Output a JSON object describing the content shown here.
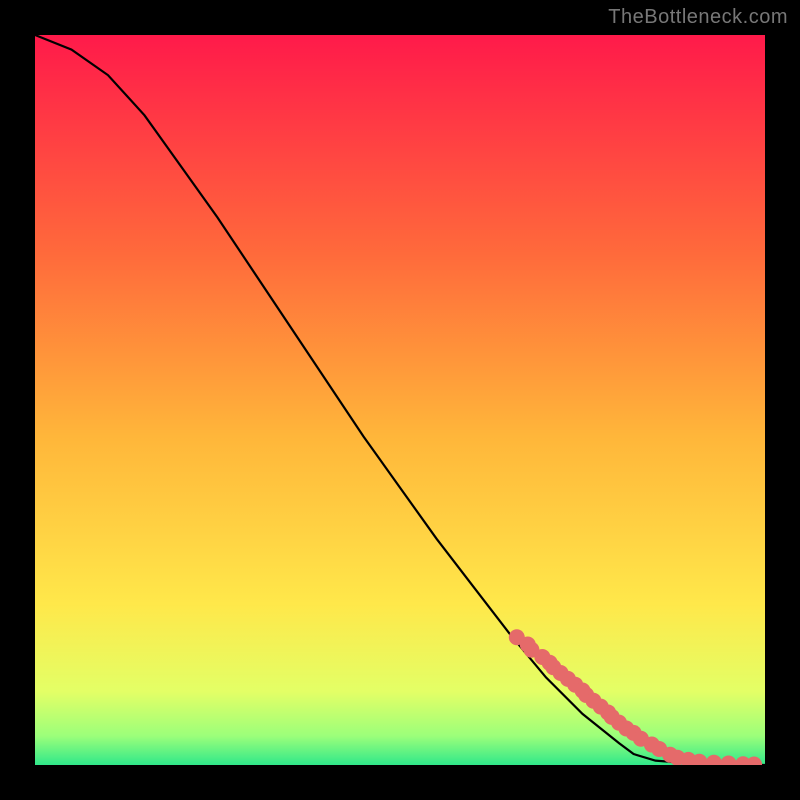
{
  "watermark": "TheBottleneck.com",
  "chart_data": {
    "type": "line",
    "title": "",
    "xlabel": "",
    "ylabel": "",
    "xlim": [
      0,
      100
    ],
    "ylim": [
      0,
      100
    ],
    "gradient_stops": [
      {
        "offset": 0,
        "color": "#ff1a4a"
      },
      {
        "offset": 0.3,
        "color": "#ff6a3b"
      },
      {
        "offset": 0.55,
        "color": "#ffb63a"
      },
      {
        "offset": 0.78,
        "color": "#ffe84a"
      },
      {
        "offset": 0.9,
        "color": "#e3ff66"
      },
      {
        "offset": 0.96,
        "color": "#9cff7a"
      },
      {
        "offset": 1.0,
        "color": "#30e88a"
      }
    ],
    "series": [
      {
        "name": "curve",
        "type": "line",
        "x": [
          0,
          5,
          10,
          15,
          20,
          25,
          30,
          35,
          40,
          45,
          50,
          55,
          60,
          65,
          70,
          75,
          80,
          82,
          85,
          90,
          95,
          100
        ],
        "y": [
          100,
          98,
          94.5,
          89,
          82,
          75,
          67.5,
          60,
          52.5,
          45,
          38,
          31,
          24.5,
          18,
          12,
          7,
          3,
          1.5,
          0.6,
          0.2,
          0.05,
          0
        ]
      },
      {
        "name": "highlight-dots",
        "type": "scatter",
        "color": "#e56a6a",
        "radius": 8,
        "x": [
          66,
          67.5,
          68,
          69.5,
          70.5,
          71,
          72,
          73,
          74,
          75,
          75.5,
          76.5,
          77.5,
          78.5,
          79,
          80,
          81,
          82,
          83,
          84.5,
          85.5,
          87,
          88,
          89.5,
          91,
          93,
          95,
          97,
          98.5
        ],
        "y": [
          17.5,
          16.5,
          15.8,
          14.8,
          14.0,
          13.4,
          12.6,
          11.8,
          11.0,
          10.2,
          9.6,
          8.8,
          8.0,
          7.2,
          6.6,
          5.8,
          5.0,
          4.4,
          3.6,
          2.8,
          2.2,
          1.4,
          1.0,
          0.7,
          0.45,
          0.3,
          0.2,
          0.1,
          0.07
        ]
      }
    ]
  }
}
